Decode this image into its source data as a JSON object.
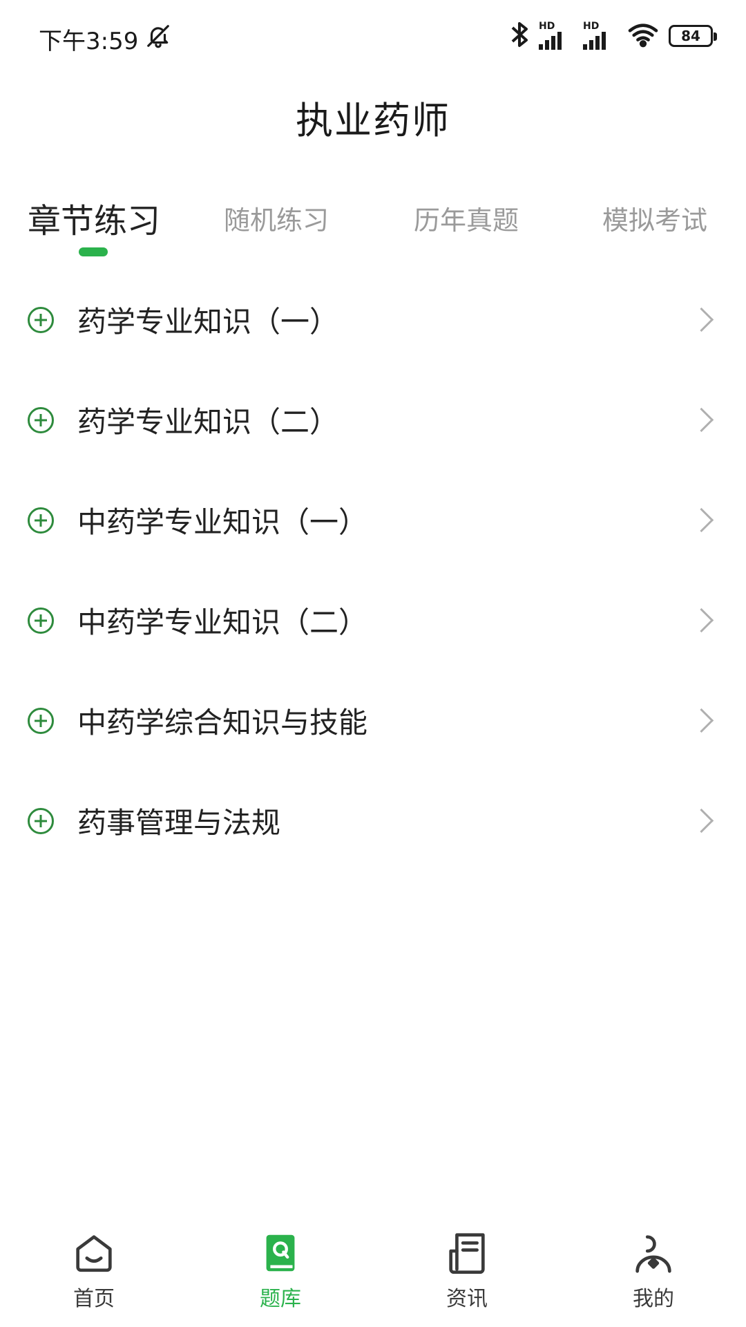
{
  "status_bar": {
    "time": "下午3:59",
    "battery": "84",
    "signal_label": "HD"
  },
  "header": {
    "title": "执业药师"
  },
  "tabs": [
    {
      "label": "章节练习",
      "active": true
    },
    {
      "label": "随机练习",
      "active": false
    },
    {
      "label": "历年真题",
      "active": false
    },
    {
      "label": "模拟考试",
      "active": false
    }
  ],
  "chapters": [
    {
      "label": "药学专业知识（一）"
    },
    {
      "label": "药学专业知识（二）"
    },
    {
      "label": "中药学专业知识（一）"
    },
    {
      "label": "中药学专业知识（二）"
    },
    {
      "label": "中药学综合知识与技能"
    },
    {
      "label": "药事管理与法规"
    }
  ],
  "bottom_nav": [
    {
      "label": "首页",
      "icon": "home-icon",
      "active": false
    },
    {
      "label": "题库",
      "icon": "question-bank-icon",
      "active": true
    },
    {
      "label": "资讯",
      "icon": "news-icon",
      "active": false
    },
    {
      "label": "我的",
      "icon": "profile-icon",
      "active": false
    }
  ],
  "colors": {
    "accent": "#2bb24c",
    "text": "#222222",
    "muted": "#9a9a9a"
  }
}
